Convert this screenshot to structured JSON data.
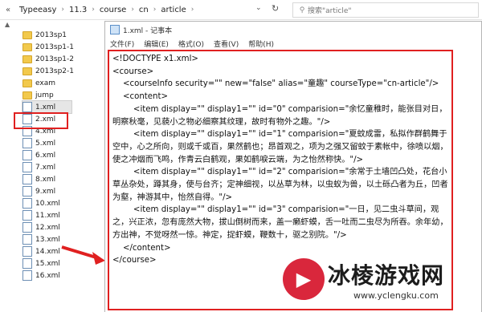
{
  "address_bar": {
    "back_label": "«",
    "crumbs": [
      "Typeeasy",
      "11.3",
      "course",
      "cn",
      "article"
    ],
    "separator": "›",
    "dropdown_glyph": "⌄",
    "refresh_glyph": "↻",
    "search_placeholder": "搜索\"article\""
  },
  "file_list": {
    "items": [
      {
        "name": "2013sp1",
        "type": "folder"
      },
      {
        "name": "2013sp1-1",
        "type": "folder"
      },
      {
        "name": "2013sp1-2",
        "type": "folder"
      },
      {
        "name": "2013sp2-1",
        "type": "folder"
      },
      {
        "name": "exam",
        "type": "folder"
      },
      {
        "name": "jump",
        "type": "folder"
      },
      {
        "name": "1.xml",
        "type": "xml",
        "selected": true
      },
      {
        "name": "2.xml",
        "type": "xml"
      },
      {
        "name": "4.xml",
        "type": "xml"
      },
      {
        "name": "5.xml",
        "type": "xml"
      },
      {
        "name": "6.xml",
        "type": "xml"
      },
      {
        "name": "7.xml",
        "type": "xml"
      },
      {
        "name": "8.xml",
        "type": "xml"
      },
      {
        "name": "9.xml",
        "type": "xml"
      },
      {
        "name": "10.xml",
        "type": "xml"
      },
      {
        "name": "11.xml",
        "type": "xml"
      },
      {
        "name": "12.xml",
        "type": "xml"
      },
      {
        "name": "13.xml",
        "type": "xml"
      },
      {
        "name": "14.xml",
        "type": "xml"
      },
      {
        "name": "15.xml",
        "type": "xml"
      },
      {
        "name": "16.xml",
        "type": "xml"
      }
    ]
  },
  "notepad": {
    "title": "1.xml - 记事本",
    "menu": [
      "文件(F)",
      "编辑(E)",
      "格式(O)",
      "查看(V)",
      "帮助(H)"
    ],
    "lines": [
      "<!DOCTYPE x1.xml>",
      "<course>",
      "    <courseInfo security=\"\" new=\"false\" alias=\"童趣\" courseType=\"cn-article\"/>",
      "    <content>",
      "        <item display=\"\" display1=\"\" id=\"0\" comparision=\"余忆童稚时，能张目对日，明察秋毫，见藐小之物必细察其纹理，故时有物外之趣。\"/>",
      "        <item display=\"\" display1=\"\" id=\"1\" comparision=\"夏蚊成雷，私拟作群鹤舞于空中，心之所向，则或千或百，果然鹤也；昂首观之，项为之强又留蚊于素帐中，徐喷以烟，使之冲烟而飞鸣，作青云白鹤观，果如鹤唳云端，为之怡然称快。\"/>",
      "        <item display=\"\" display1=\"\" id=\"2\" comparision=\"余常于土墙凹凸处，花台小草丛杂处，蹲其身，使与台齐；定神细视，以丛草为林，以虫蚁为兽，以土砾凸者为丘，凹者为壑，神游其中，怡然自得。\"/>",
      "        <item display=\"\" display1=\"\" id=\"3\" comparision=\"一日，见二虫斗草间，观之，兴正浓，忽有庞然大物，拔山倒树而来，盖一癞虾蟆，舌一吐而二虫尽为所吞。余年幼，方出神，不觉呀然一惊。神定，捉虾蟆，鞭数十，驱之别院。\"/>",
      "    </content>",
      "</course>"
    ]
  },
  "watermark": {
    "title": "冰棱游戏网",
    "url": "www.yclengku.com",
    "logo_glyph": "▶"
  },
  "colors": {
    "highlight_red": "#e02020",
    "folder_yellow": "#f2c94c"
  }
}
